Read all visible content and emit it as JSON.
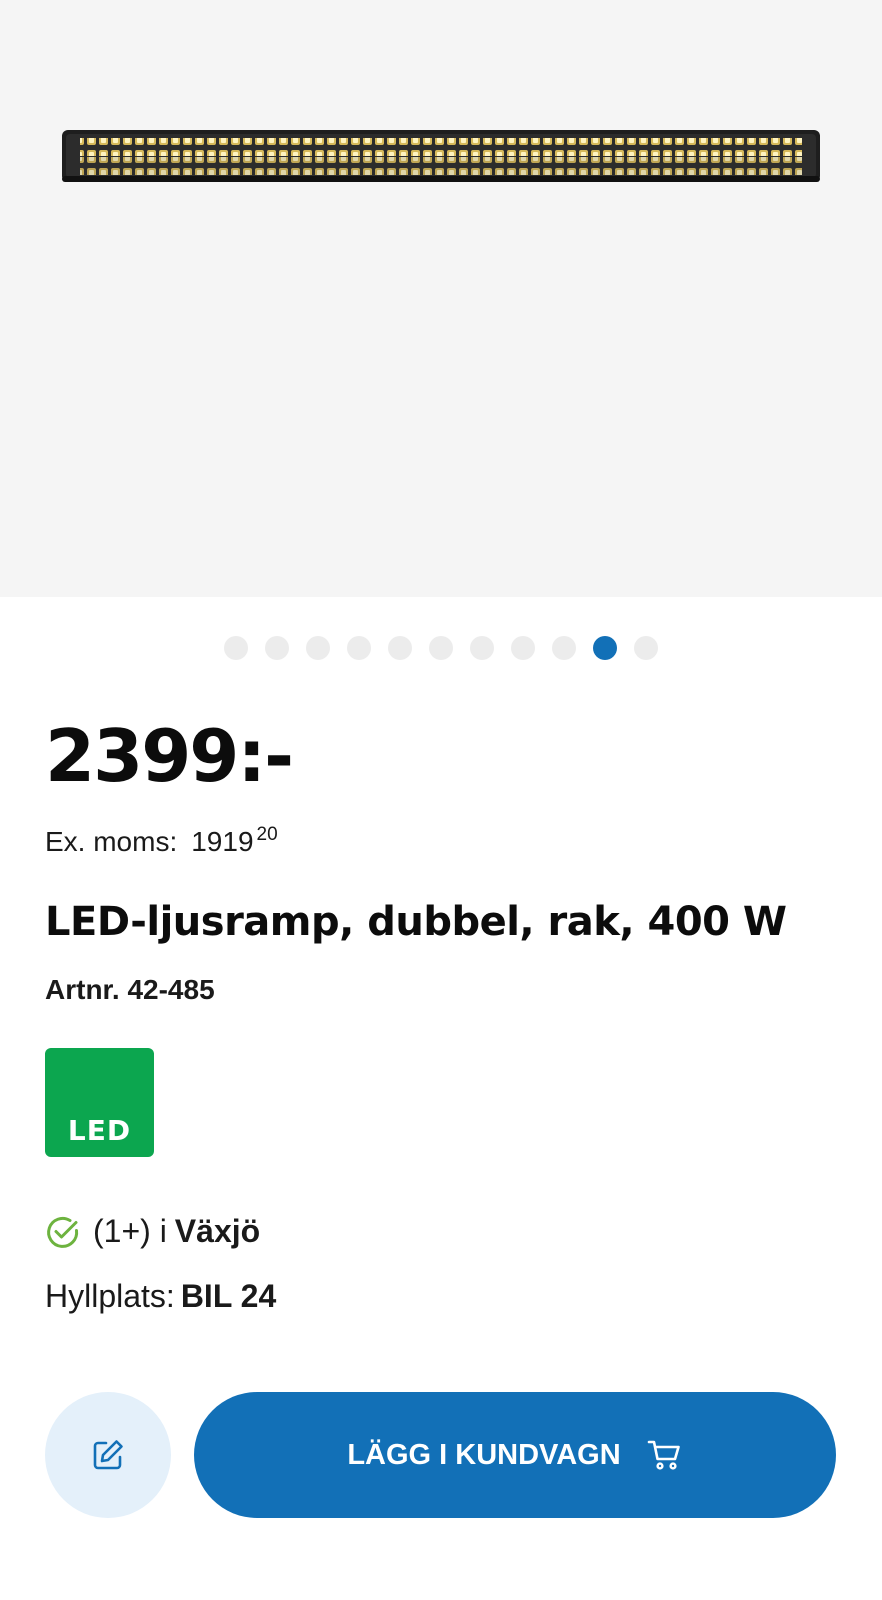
{
  "gallery": {
    "image_alt": "LED-ljusramp",
    "slide_count": 11,
    "active_slide": 10
  },
  "product": {
    "price": "2399:-",
    "ex_moms_label": "Ex. moms:",
    "ex_moms_value": "1919",
    "ex_moms_decimals": "20",
    "title": "LED-ljusramp, dubbel, rak, 400 W",
    "artnr": "Artnr. 42-485",
    "badge_label": "LED"
  },
  "stock": {
    "quantity": "(1+) i",
    "store": "Växjö",
    "icon": "check-circle-icon"
  },
  "shelf": {
    "label": "Hyllplats:",
    "value": "BIL 24"
  },
  "actions": {
    "edit_icon": "edit-icon",
    "add_to_cart_label": "LÄGG I KUNDVAGN",
    "cart_icon": "cart-icon"
  },
  "colors": {
    "accent": "#1270b7",
    "led_badge": "#0ca64f",
    "stock_ok": "#6db33f",
    "edit_bg": "#e4f0fa"
  }
}
